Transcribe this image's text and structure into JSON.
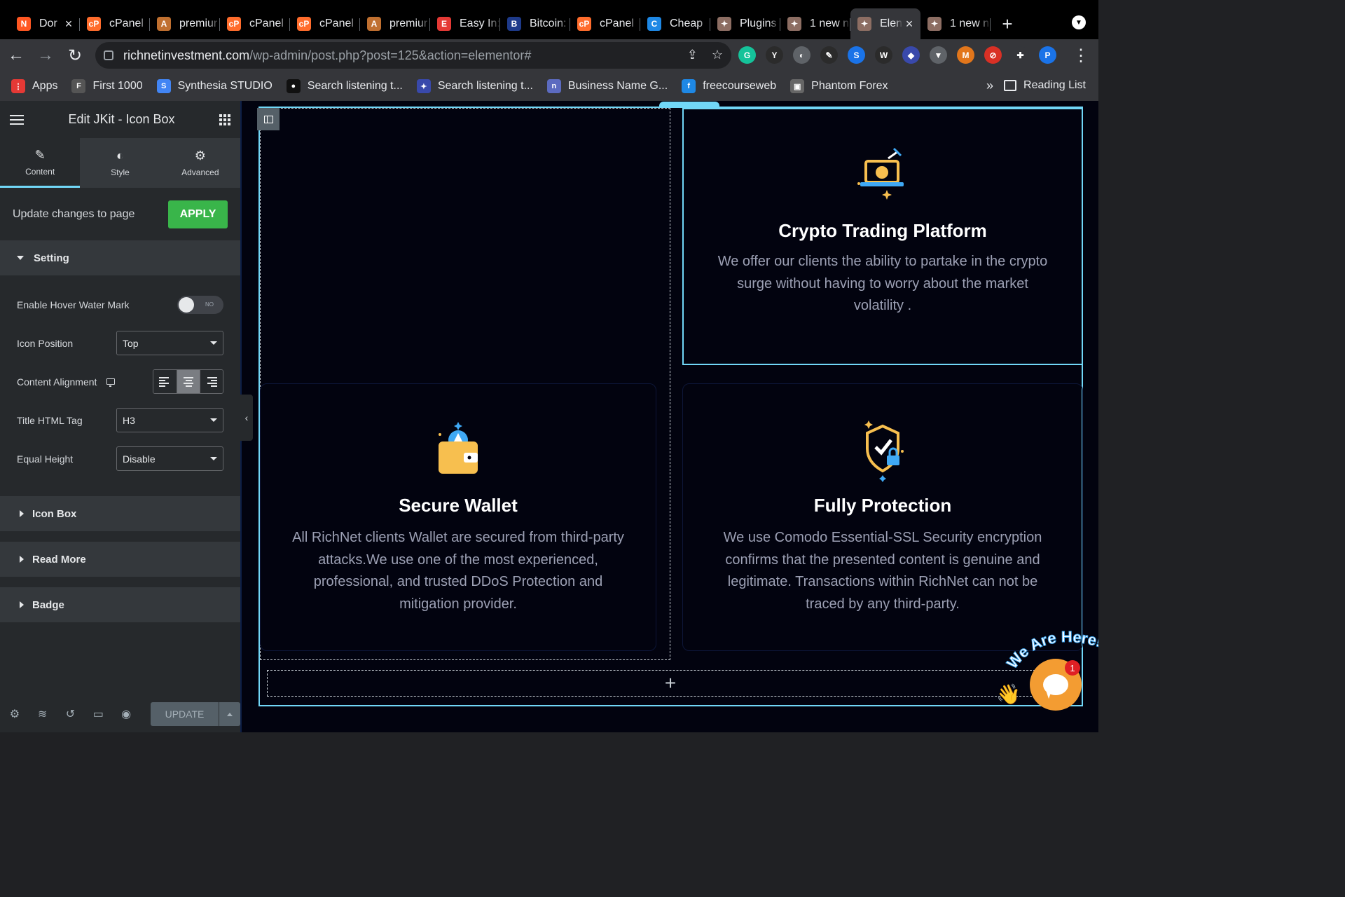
{
  "browser": {
    "tabs": [
      {
        "title": "Dor",
        "favicon_color": "#ff5722",
        "glyph": "N",
        "active": false,
        "closable": true
      },
      {
        "title": "cPanel",
        "favicon_color": "#ff6c2c",
        "glyph": "cP",
        "active": false
      },
      {
        "title": "premiur",
        "favicon_color": "#c07030",
        "glyph": "A",
        "active": false
      },
      {
        "title": "cPanel",
        "favicon_color": "#ff6c2c",
        "glyph": "cP",
        "active": false
      },
      {
        "title": "cPanel",
        "favicon_color": "#ff6c2c",
        "glyph": "cP",
        "active": false
      },
      {
        "title": "premiur",
        "favicon_color": "#c07030",
        "glyph": "A",
        "active": false
      },
      {
        "title": "Easy In:",
        "favicon_color": "#e53935",
        "glyph": "E",
        "active": false
      },
      {
        "title": "Bitcoin:",
        "favicon_color": "#1e3a8a",
        "glyph": "B",
        "active": false
      },
      {
        "title": "cPanel",
        "favicon_color": "#ff6c2c",
        "glyph": "cP",
        "active": false
      },
      {
        "title": "Cheap",
        "favicon_color": "#1e88e5",
        "glyph": "C",
        "active": false
      },
      {
        "title": "Plugins",
        "favicon_color": "#8d6e63",
        "glyph": "✦",
        "active": false
      },
      {
        "title": "1 new n",
        "favicon_color": "#8d6e63",
        "glyph": "✦",
        "active": false
      },
      {
        "title": "Elen",
        "favicon_color": "#8d6e63",
        "glyph": "✦",
        "active": true,
        "closable": true
      },
      {
        "title": "1 new n",
        "favicon_color": "#8d6e63",
        "glyph": "✦",
        "active": false
      }
    ],
    "new_tab_label": "+",
    "url_domain": "richnetinvestment.com",
    "url_path": "/wp-admin/post.php?post=125&action=elementor#",
    "extensions": [
      {
        "name": "grammarly",
        "color": "#15c39a",
        "glyph": "G"
      },
      {
        "name": "yoast",
        "color": "#2b2b2b",
        "glyph": "Y"
      },
      {
        "name": "ext-circle",
        "color": "#5f6368",
        "glyph": "◐"
      },
      {
        "name": "ext-pen",
        "color": "#2b2b2b",
        "glyph": "✎"
      },
      {
        "name": "ext-s",
        "color": "#1a73e8",
        "glyph": "S"
      },
      {
        "name": "wordpress",
        "color": "#2b2b2b",
        "glyph": "W"
      },
      {
        "name": "ext-shield",
        "color": "#3949ab",
        "glyph": "◆"
      },
      {
        "name": "ext-v",
        "color": "#5f6368",
        "glyph": "▼"
      },
      {
        "name": "metamask",
        "color": "#e2761b",
        "glyph": "M"
      },
      {
        "name": "ext-block",
        "color": "#d93025",
        "glyph": "⊘"
      },
      {
        "name": "extensions-puzzle",
        "color": "#35363a",
        "glyph": "✚"
      },
      {
        "name": "profile",
        "color": "#1a73e8",
        "glyph": "P"
      }
    ],
    "bookmarks": [
      {
        "label": "Apps",
        "color": "#e53935",
        "glyph": "⋮"
      },
      {
        "label": "First 1000",
        "color": "#555",
        "glyph": "F"
      },
      {
        "label": "Synthesia STUDIO",
        "color": "#4285f4",
        "glyph": "S"
      },
      {
        "label": "Search listening t...",
        "color": "#111",
        "glyph": "●"
      },
      {
        "label": "Search listening t...",
        "color": "#3949ab",
        "glyph": "✦"
      },
      {
        "label": "Business Name G...",
        "color": "#5c6bc0",
        "glyph": "n"
      },
      {
        "label": "freecourseweb",
        "color": "#1e88e5",
        "glyph": "f"
      },
      {
        "label": "Phantom Forex",
        "color": "#666",
        "glyph": "▣"
      }
    ],
    "bookmarks_overflow": "»",
    "reading_list_label": "Reading List"
  },
  "panel": {
    "title": "Edit JKit - Icon Box",
    "tabs": [
      {
        "label": "Content",
        "icon": "pencil-icon",
        "glyph": "✎",
        "active": true
      },
      {
        "label": "Style",
        "icon": "half-circle-icon",
        "glyph": "◐",
        "active": false
      },
      {
        "label": "Advanced",
        "icon": "gear-icon",
        "glyph": "⚙",
        "active": false
      }
    ],
    "apply_text": "Update changes to page",
    "apply_label": "APPLY",
    "setting_section": {
      "title": "Setting",
      "hover_watermark_label": "Enable Hover Water Mark",
      "hover_watermark_state": "NO",
      "icon_position_label": "Icon Position",
      "icon_position_value": "Top",
      "content_alignment_label": "Content Alignment",
      "content_alignment_value": "center",
      "title_tag_label": "Title HTML Tag",
      "title_tag_value": "H3",
      "equal_height_label": "Equal Height",
      "equal_height_value": "Disable"
    },
    "collapsed_sections": [
      "Icon Box",
      "Read More",
      "Badge"
    ],
    "footer": {
      "update_label": "UPDATE"
    }
  },
  "canvas": {
    "cards": [
      {
        "id": "crypto",
        "title": "Crypto Trading Platform",
        "text": "We offer our clients the ability to partake in the crypto surge without having to worry about the market volatility .",
        "icon": "crypto-trading-icon",
        "selected": true
      },
      {
        "id": "wallet",
        "title": "Secure Wallet",
        "text": "All RichNet clients Wallet are secured from third-party attacks.We use one of the most experienced, professional, and trusted DDoS Protection and mitigation provider.",
        "icon": "wallet-icon",
        "selected": false
      },
      {
        "id": "protection",
        "title": "Fully Protection",
        "text": "We use Comodo Essential-SSL Security encryption confirms that the presented content is genuine and legitimate. Transactions within RichNet can not be traced by any third-party.",
        "icon": "shield-check-icon",
        "selected": false
      }
    ],
    "add_section_label": "+"
  },
  "chat": {
    "tagline": "We Are Here!",
    "badge_count": "1"
  },
  "colors": {
    "accent": "#71d7f7",
    "apply_green": "#39b54a",
    "canvas_bg": "#02030f",
    "icon_yellow": "#f7bf4f",
    "icon_blue": "#3fa9f5",
    "chat_orange": "#f39c32"
  }
}
